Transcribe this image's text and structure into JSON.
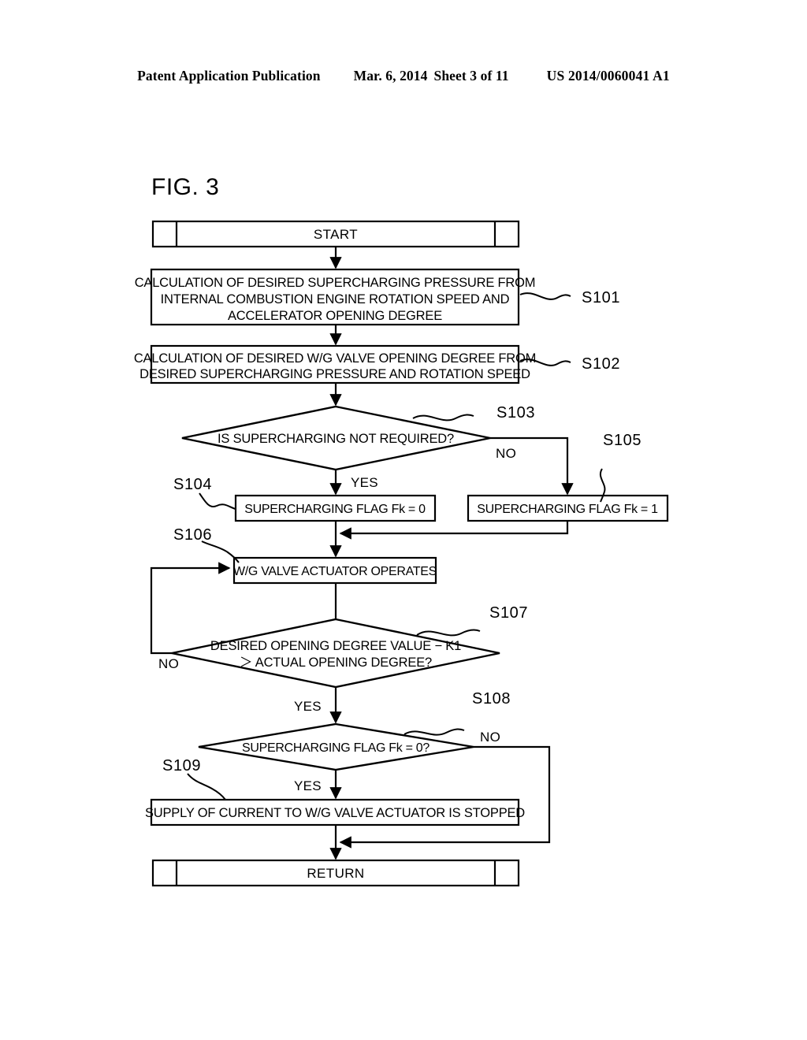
{
  "header": {
    "publication": "Patent Application Publication",
    "date": "Mar. 6, 2014",
    "sheet": "Sheet 3 of 11",
    "patent_number": "US 2014/0060041 A1"
  },
  "figure": {
    "title": "FIG. 3"
  },
  "flowchart": {
    "start": {
      "label": "START"
    },
    "end": {
      "label": "RETURN"
    },
    "steps": [
      {
        "id": "S101",
        "type": "process",
        "lines": [
          "CALCULATION OF DESIRED SUPERCHARGING PRESSURE FROM",
          "INTERNAL COMBUSTION ENGINE ROTATION SPEED AND",
          "ACCELERATOR OPENING DEGREE"
        ]
      },
      {
        "id": "S102",
        "type": "process",
        "lines": [
          "CALCULATION OF DESIRED W/G VALVE OPENING DEGREE FROM",
          "DESIRED SUPERCHARGING PRESSURE AND ROTATION SPEED"
        ]
      },
      {
        "id": "S103",
        "type": "decision",
        "lines": [
          "IS SUPERCHARGING NOT REQUIRED?"
        ]
      },
      {
        "id": "S104",
        "type": "process",
        "lines": [
          "SUPERCHARGING FLAG Fk = 0"
        ]
      },
      {
        "id": "S105",
        "type": "process",
        "lines": [
          "SUPERCHARGING FLAG Fk = 1"
        ]
      },
      {
        "id": "S106",
        "type": "process",
        "lines": [
          "W/G VALVE ACTUATOR OPERATES"
        ]
      },
      {
        "id": "S107",
        "type": "decision",
        "lines": [
          "DESIRED OPENING DEGREE VALUE − K1",
          "＞ ACTUAL OPENING DEGREE?"
        ]
      },
      {
        "id": "S108",
        "type": "decision",
        "lines": [
          "SUPERCHARGING FLAG Fk = 0?"
        ]
      },
      {
        "id": "S109",
        "type": "process",
        "lines": [
          "SUPPLY OF CURRENT TO W/G VALVE ACTUATOR IS STOPPED"
        ]
      }
    ],
    "branch_labels": {
      "s103_yes": "YES",
      "s103_no": "NO",
      "s107_no": "NO",
      "s107_yes": "YES",
      "s108_no": "NO",
      "s108_yes": "YES"
    },
    "colors": {
      "ink": "#000000",
      "paper": "#ffffff"
    }
  }
}
